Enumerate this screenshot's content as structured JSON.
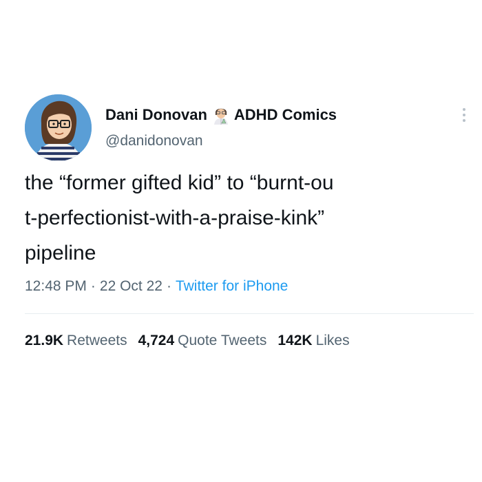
{
  "author": {
    "display_name": "Dani Donovan",
    "name_emoji": "scientist-emoji",
    "name_suffix": "ADHD Comics",
    "handle": "@danidonovan",
    "avatar_icon": "cartoon-portrait-avatar"
  },
  "tweet": {
    "lines": [
      "the “former gifted kid” to “burnt-ou",
      "t-perfectionist-with-a-praise-kink”",
      "pipeline"
    ]
  },
  "meta": {
    "time": "12:48 PM",
    "separator": "·",
    "date": "22 Oct 22",
    "source": "Twitter for iPhone"
  },
  "stats": {
    "retweets_count": "21.9K",
    "retweets_label": "Retweets",
    "quotes_count": "4,724",
    "quotes_label": "Quote Tweets",
    "likes_count": "142K",
    "likes_label": "Likes"
  },
  "colors": {
    "text": "#0f1419",
    "secondary": "#536471",
    "link": "#1d9bf0",
    "divider": "#e6ecf0",
    "avatar_bg": "#5a9ed6"
  }
}
